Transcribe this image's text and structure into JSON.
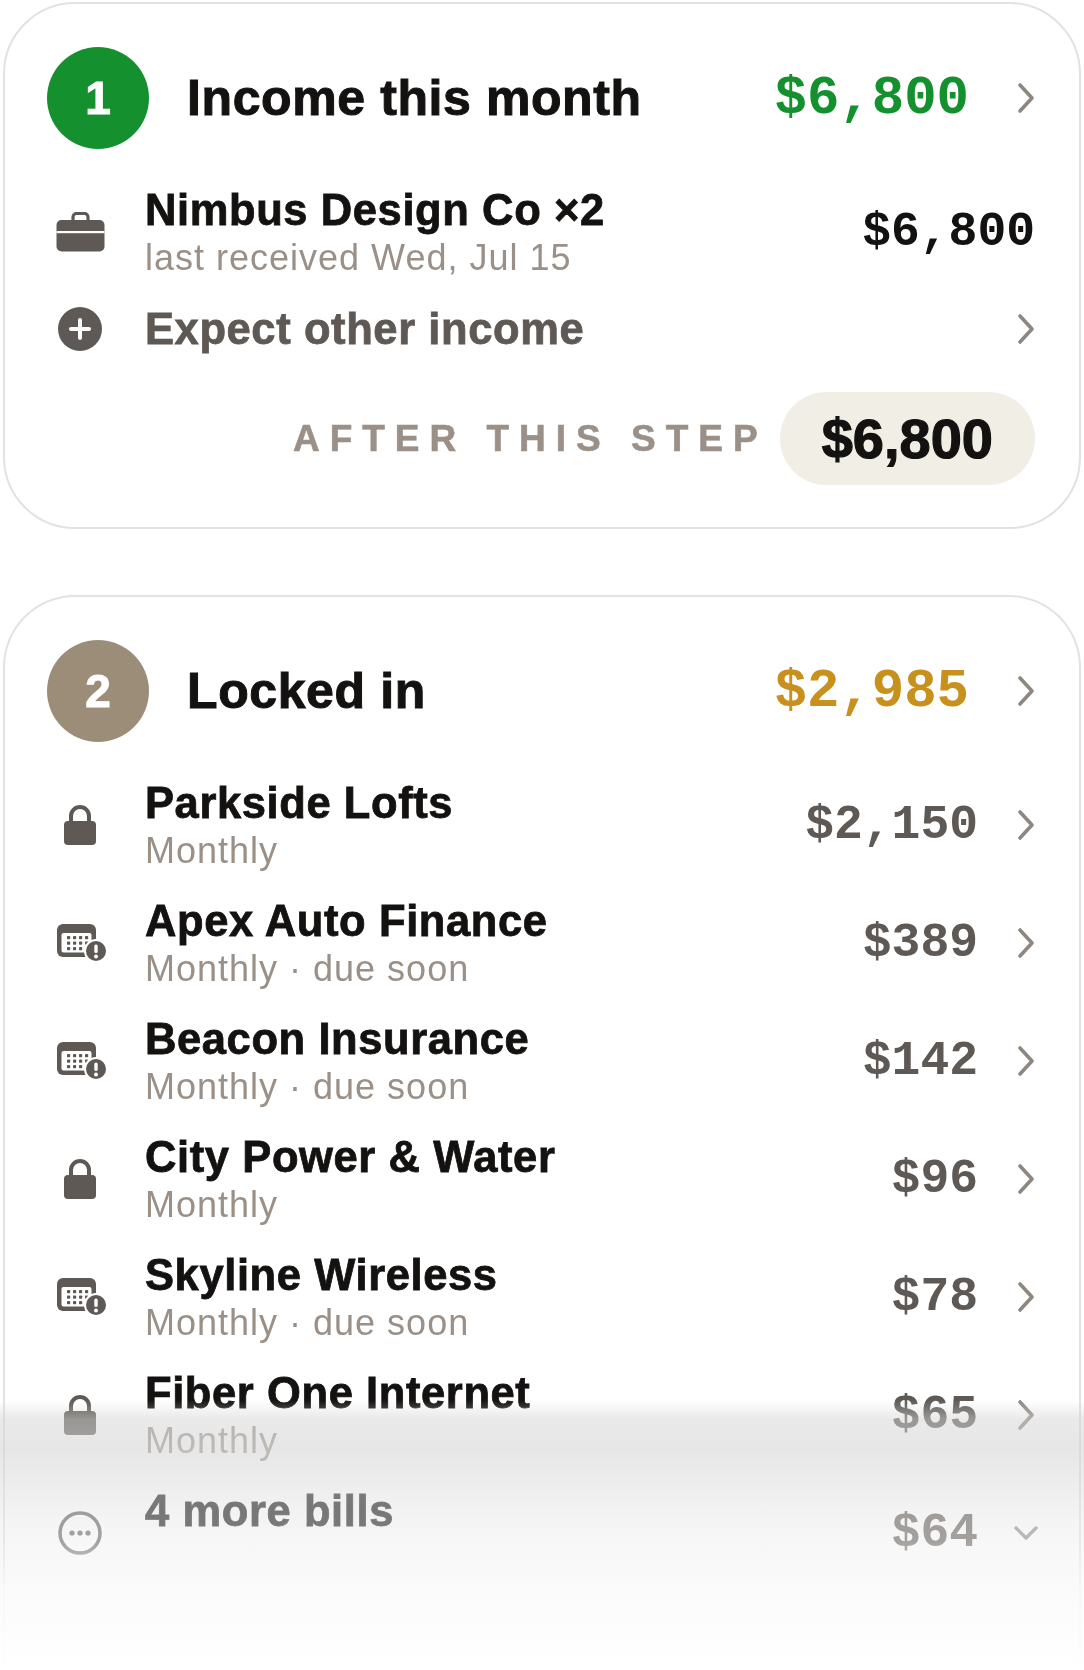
{
  "steps": [
    {
      "number": "1",
      "title": "Income this month",
      "total": "$6,800",
      "kind": "income",
      "color": "#15902f",
      "link": true,
      "items": [
        {
          "kind": "source",
          "name": "Nimbus Design Co ×2",
          "detail": "last received Wed, Jul 15",
          "amount": "$6,800"
        },
        {
          "kind": "add",
          "name": "Expect other income",
          "link": true
        }
      ],
      "summary": {
        "label": "AFTER THIS STEP",
        "amount": "$6,800"
      }
    },
    {
      "number": "2",
      "title": "Locked in",
      "total": "$2,985",
      "kind": "locked",
      "color": "#9c8d79",
      "link": true,
      "items": [
        {
          "kind": "locked",
          "name": "Parkside Lofts",
          "detail": "Monthly",
          "amount": "$2,150",
          "link": true
        },
        {
          "kind": "due",
          "name": "Apex Auto Finance",
          "detail": "Monthly · due soon",
          "amount": "$389",
          "link": true
        },
        {
          "kind": "due",
          "name": "Beacon Insurance",
          "detail": "Monthly · due soon",
          "amount": "$142",
          "link": true
        },
        {
          "kind": "locked",
          "name": "City Power & Water",
          "detail": "Monthly",
          "amount": "$96",
          "link": true
        },
        {
          "kind": "due",
          "name": "Skyline Wireless",
          "detail": "Monthly · due soon",
          "amount": "$78",
          "link": true
        },
        {
          "kind": "locked",
          "name": "Fiber One Internet",
          "detail": "Monthly",
          "amount": "$65",
          "link": true
        },
        {
          "kind": "more",
          "name": "4 more bills",
          "amount": "$64",
          "expanded": false
        }
      ]
    }
  ]
}
